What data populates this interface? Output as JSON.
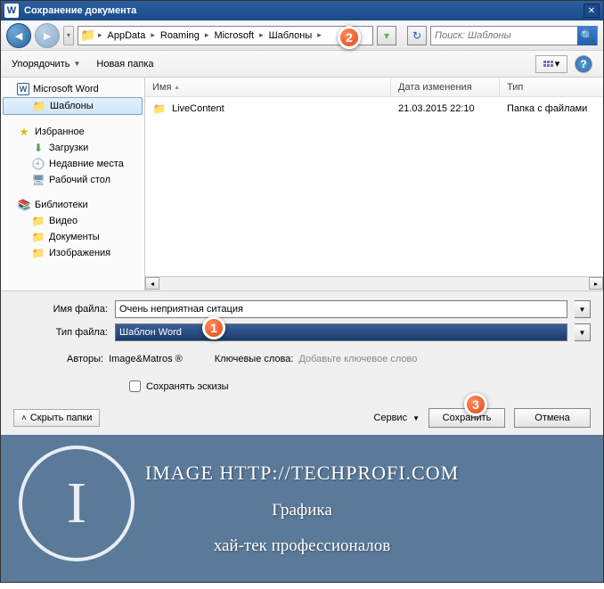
{
  "window": {
    "title": "Сохранение документа",
    "app_icon_letter": "W"
  },
  "nav": {
    "breadcrumbs": [
      "AppData",
      "Roaming",
      "Microsoft",
      "Шаблоны"
    ],
    "search_placeholder": "Поиск: Шаблоны"
  },
  "toolbar": {
    "organize": "Упорядочить",
    "new_folder": "Новая папка"
  },
  "sidebar": {
    "groups": [
      {
        "items": [
          {
            "label": "Microsoft Word",
            "icon": "word"
          },
          {
            "label": "Шаблоны",
            "icon": "folder",
            "selected": true
          }
        ]
      },
      {
        "items": [
          {
            "label": "Избранное",
            "icon": "star"
          },
          {
            "label": "Загрузки",
            "icon": "download",
            "indent": true
          },
          {
            "label": "Недавние места",
            "icon": "recent",
            "indent": true
          },
          {
            "label": "Рабочий стол",
            "icon": "desktop",
            "indent": true
          }
        ]
      },
      {
        "items": [
          {
            "label": "Библиотеки",
            "icon": "library"
          },
          {
            "label": "Видео",
            "icon": "folder",
            "indent": true
          },
          {
            "label": "Документы",
            "icon": "folder",
            "indent": true
          },
          {
            "label": "Изображения",
            "icon": "folder",
            "indent": true
          }
        ]
      }
    ]
  },
  "filelist": {
    "columns": {
      "name": "Имя",
      "date": "Дата изменения",
      "type": "Тип"
    },
    "rows": [
      {
        "name": "LiveContent",
        "date": "21.03.2015 22:10",
        "type": "Папка с файлами"
      }
    ]
  },
  "form": {
    "filename_label": "Имя файла:",
    "filename_value": "Очень неприятная ситация",
    "filetype_label": "Тип файла:",
    "filetype_value": "Шаблон Word",
    "authors_label": "Авторы:",
    "authors_value": "Image&Matros ®",
    "keywords_label": "Ключевые слова:",
    "keywords_hint": "Добавьте ключевое слово",
    "save_thumb": "Сохранять эскизы",
    "hide_folders": "Скрыть папки",
    "service": "Сервис",
    "save": "Сохранить",
    "cancel": "Отмена"
  },
  "markers": {
    "m1": "1",
    "m2": "2",
    "m3": "3"
  },
  "footer": {
    "logo_letter": "I",
    "url": "IMAGE HTTP://TECHPROFI.COM",
    "line1": "Графика",
    "line2": "хай-тек профессионалов"
  }
}
